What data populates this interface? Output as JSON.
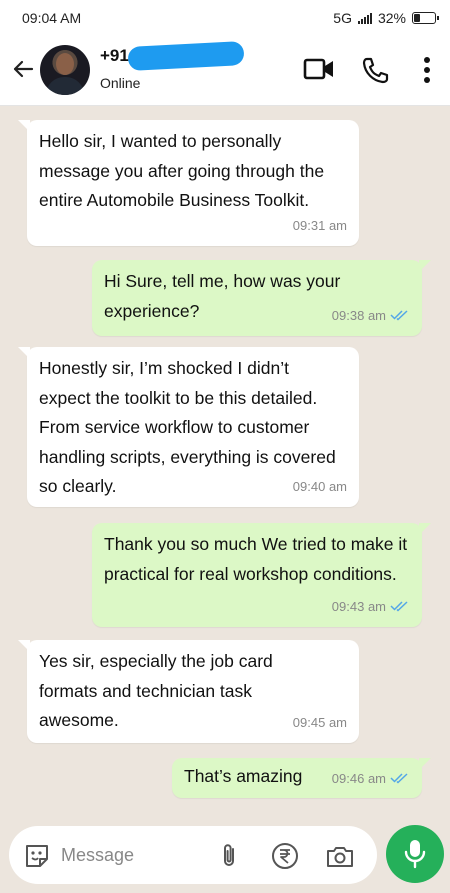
{
  "status_bar": {
    "time": "09:04 AM",
    "network": "5G",
    "battery": "32%",
    "battery_level": 0.32
  },
  "header": {
    "contact_name": "+91",
    "contact_status": "Online"
  },
  "messages": [
    {
      "direction": "incoming",
      "text": "Hello sir, I wanted to personally message you after going through the entire Automobile Business Toolkit.",
      "time": "09:31 am"
    },
    {
      "direction": "outgoing",
      "text": "Hi Sure, tell me, how was your experience?",
      "time": "09:38 am",
      "read": true
    },
    {
      "direction": "incoming",
      "text": "Honestly sir, I’m shocked I didn’t expect the toolkit to be this detailed. From service workflow to customer handling scripts, everything is covered so clearly.",
      "time": "09:40 am"
    },
    {
      "direction": "outgoing",
      "text": "Thank you so much We tried to make it practical for real workshop conditions.",
      "time": "09:43 am",
      "read": true
    },
    {
      "direction": "incoming",
      "text": "Yes sir, especially the job card formats and technician task awesome.",
      "time": "09:45 am"
    },
    {
      "direction": "outgoing",
      "text": "That’s amazing",
      "time": "09:46 am",
      "read": true
    }
  ],
  "input": {
    "placeholder": "Message"
  },
  "colors": {
    "incoming_bubble": "#ffffff",
    "outgoing_bubble": "#dcf8c6",
    "read_ticks": "#53a6e8",
    "mic_button": "#25b05a",
    "redaction": "#1e9bf0"
  }
}
